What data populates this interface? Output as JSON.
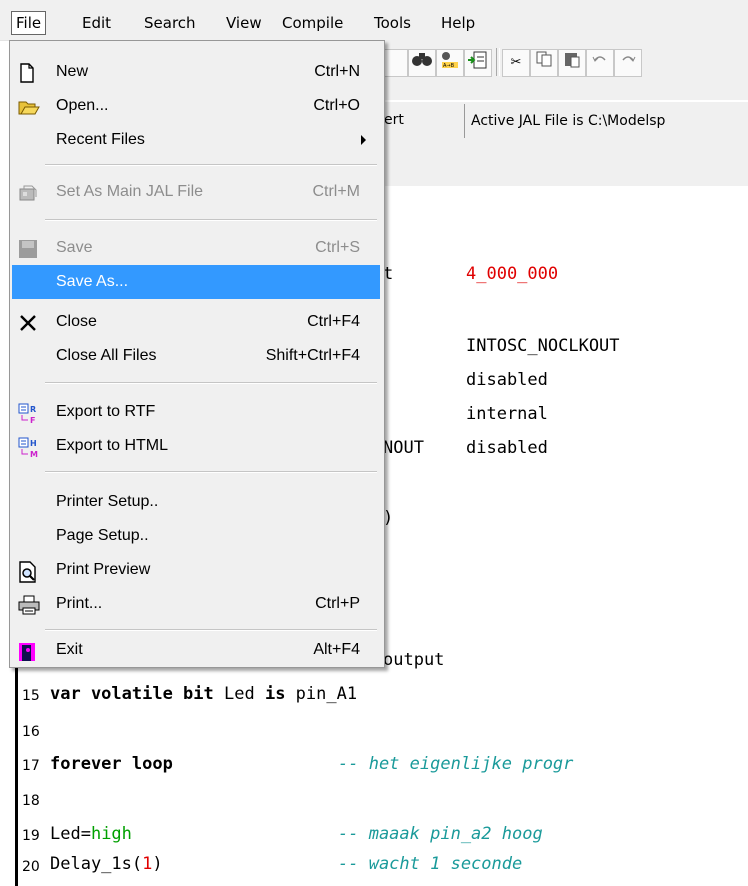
{
  "menubar": [
    "File",
    "Edit",
    "Search",
    "View",
    "Compile",
    "Tools",
    "Help"
  ],
  "file_menu": {
    "new": {
      "label": "New",
      "shortcut": "Ctrl+N"
    },
    "open": {
      "label": "Open...",
      "shortcut": "Ctrl+O"
    },
    "recent": {
      "label": "Recent Files"
    },
    "set_main": {
      "label": "Set As Main JAL File",
      "shortcut": "Ctrl+M"
    },
    "save": {
      "label": "Save",
      "shortcut": "Ctrl+S"
    },
    "save_as": {
      "label": "Save As..."
    },
    "close": {
      "label": "Close",
      "shortcut": "Ctrl+F4"
    },
    "close_all": {
      "label": "Close All Files",
      "shortcut": "Shift+Ctrl+F4"
    },
    "export_rtf": {
      "label": "Export to RTF"
    },
    "export_html": {
      "label": "Export to HTML"
    },
    "printer_setup": {
      "label": "Printer Setup.."
    },
    "page_setup": {
      "label": "Page Setup.."
    },
    "print_preview": {
      "label": "Print Preview"
    },
    "print": {
      "label": "Print...",
      "shortcut": "Ctrl+P"
    },
    "exit": {
      "label": "Exit",
      "shortcut": "Alt+F4"
    }
  },
  "statusbar": {
    "insert": "ert",
    "active_file": "Active JAL File is C:\\Modelsp"
  },
  "code": {
    "l_clock_tail": "t",
    "l_clock_val": "4_000_000",
    "l_osc_val": "INTOSC_NOCLKOUT",
    "l_wdt_val": "disabled",
    "l_mclr_val": "internal",
    "l_clkout_tail": "NOUT",
    "l_clkout_val": "disabled",
    "l_paren": ")",
    "l13_tail": "output",
    "n15": "15",
    "l15_a": "var volatile bit ",
    "l15_b": "Led ",
    "l15_c": "is ",
    "l15_d": "pin_A1",
    "n16": "16",
    "n17": "17",
    "l17_a": "forever loop",
    "l17_c": "-- het eigenlijke progr",
    "n18": "18",
    "n19": "19",
    "l19_a": "Led=",
    "l19_b": "high",
    "l19_c": "-- maaak pin_a2 hoog",
    "n20": "20",
    "l20_a": "Delay_1s(",
    "l20_b": "1",
    "l20_c": ")",
    "l20_d": "-- wacht 1 seconde"
  }
}
